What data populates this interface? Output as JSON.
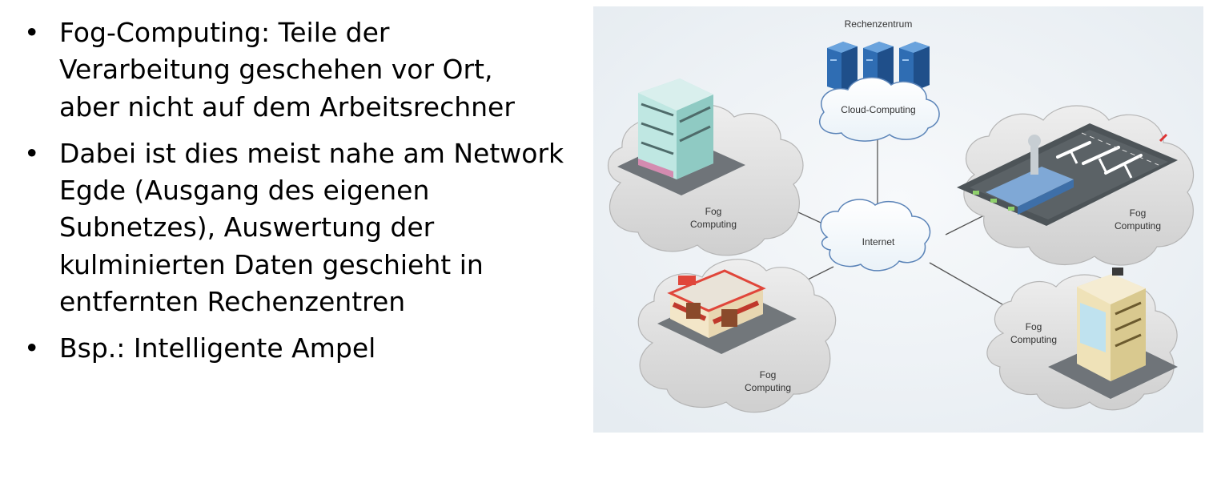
{
  "bullets": [
    {
      "text": "Fog-Computing: Teile der Verarbeitung geschehen vor Ort, aber nicht auf dem Arbeitsrechner"
    },
    {
      "text": "Dabei ist dies meist nahe am Network Egde (Ausgang des eigenen Subnetzes), Auswertung der kulminierten Daten geschieht in entfernten Rechenzentren"
    },
    {
      "text": "Bsp.: Intelligente Ampel"
    }
  ],
  "diagram": {
    "datacenter_label": "Rechenzentrum",
    "cloud_label": "Cloud-Computing",
    "internet_label": "Internet",
    "fog_line1": "Fog",
    "fog_line2": "Computing"
  },
  "colors": {
    "cloud_fill": "#d9d9d9",
    "cloud_stroke": "#b5b5b5",
    "server": "#3d7fc1",
    "background": "#eef2f6"
  }
}
